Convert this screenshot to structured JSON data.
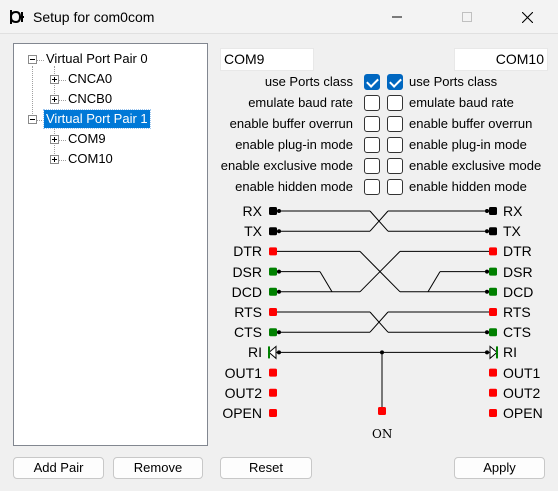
{
  "window": {
    "title": "Setup for com0com",
    "app_icon": "com0com-icon",
    "minimize_icon": "minimize-icon",
    "maximize_icon": "maximize-icon",
    "close_icon": "close-icon"
  },
  "tree": {
    "pairs": [
      {
        "label": "Virtual Port Pair 0",
        "expanded": true,
        "selected": false,
        "ports": [
          {
            "label": "CNCA0",
            "expanded": false
          },
          {
            "label": "CNCB0",
            "expanded": false
          }
        ]
      },
      {
        "label": "Virtual Port Pair 1",
        "expanded": true,
        "selected": true,
        "ports": [
          {
            "label": "COM9",
            "expanded": false
          },
          {
            "label": "COM10",
            "expanded": false
          }
        ]
      }
    ]
  },
  "ports": {
    "left_name": "COM9",
    "right_name": "COM10"
  },
  "options": [
    {
      "label": "use Ports class",
      "left_checked": true,
      "right_checked": true
    },
    {
      "label": "emulate baud rate",
      "left_checked": false,
      "right_checked": false
    },
    {
      "label": "enable buffer overrun",
      "left_checked": false,
      "right_checked": false
    },
    {
      "label": "enable plug-in mode",
      "left_checked": false,
      "right_checked": false
    },
    {
      "label": "enable exclusive mode",
      "left_checked": false,
      "right_checked": false
    },
    {
      "label": "enable hidden mode",
      "left_checked": false,
      "right_checked": false
    }
  ],
  "signals": {
    "left": [
      {
        "name": "RX",
        "color": "#000000"
      },
      {
        "name": "TX",
        "color": "#000000"
      },
      {
        "name": "DTR",
        "color": "#ff0000"
      },
      {
        "name": "DSR",
        "color": "#008000"
      },
      {
        "name": "DCD",
        "color": "#008000"
      },
      {
        "name": "RTS",
        "color": "#ff0000"
      },
      {
        "name": "CTS",
        "color": "#008000"
      },
      {
        "name": "RI",
        "color": "#008000"
      },
      {
        "name": "OUT1",
        "color": "#ff0000"
      },
      {
        "name": "OUT2",
        "color": "#ff0000"
      },
      {
        "name": "OPEN",
        "color": "#ff0000"
      }
    ],
    "right": [
      {
        "name": "RX",
        "color": "#000000"
      },
      {
        "name": "TX",
        "color": "#000000"
      },
      {
        "name": "DTR",
        "color": "#ff0000"
      },
      {
        "name": "DSR",
        "color": "#008000"
      },
      {
        "name": "DCD",
        "color": "#008000"
      },
      {
        "name": "RTS",
        "color": "#ff0000"
      },
      {
        "name": "CTS",
        "color": "#008000"
      },
      {
        "name": "RI",
        "color": "#008000"
      },
      {
        "name": "OUT1",
        "color": "#ff0000"
      },
      {
        "name": "OUT2",
        "color": "#ff0000"
      },
      {
        "name": "OPEN",
        "color": "#ff0000"
      }
    ],
    "on_label": "ON",
    "on_color": "#ff0000"
  },
  "buttons": {
    "add_pair": "Add Pair",
    "remove": "Remove",
    "reset": "Reset",
    "apply": "Apply"
  },
  "colors": {
    "selection": "#0078d7",
    "checkbox_checked": "#0067c0"
  }
}
